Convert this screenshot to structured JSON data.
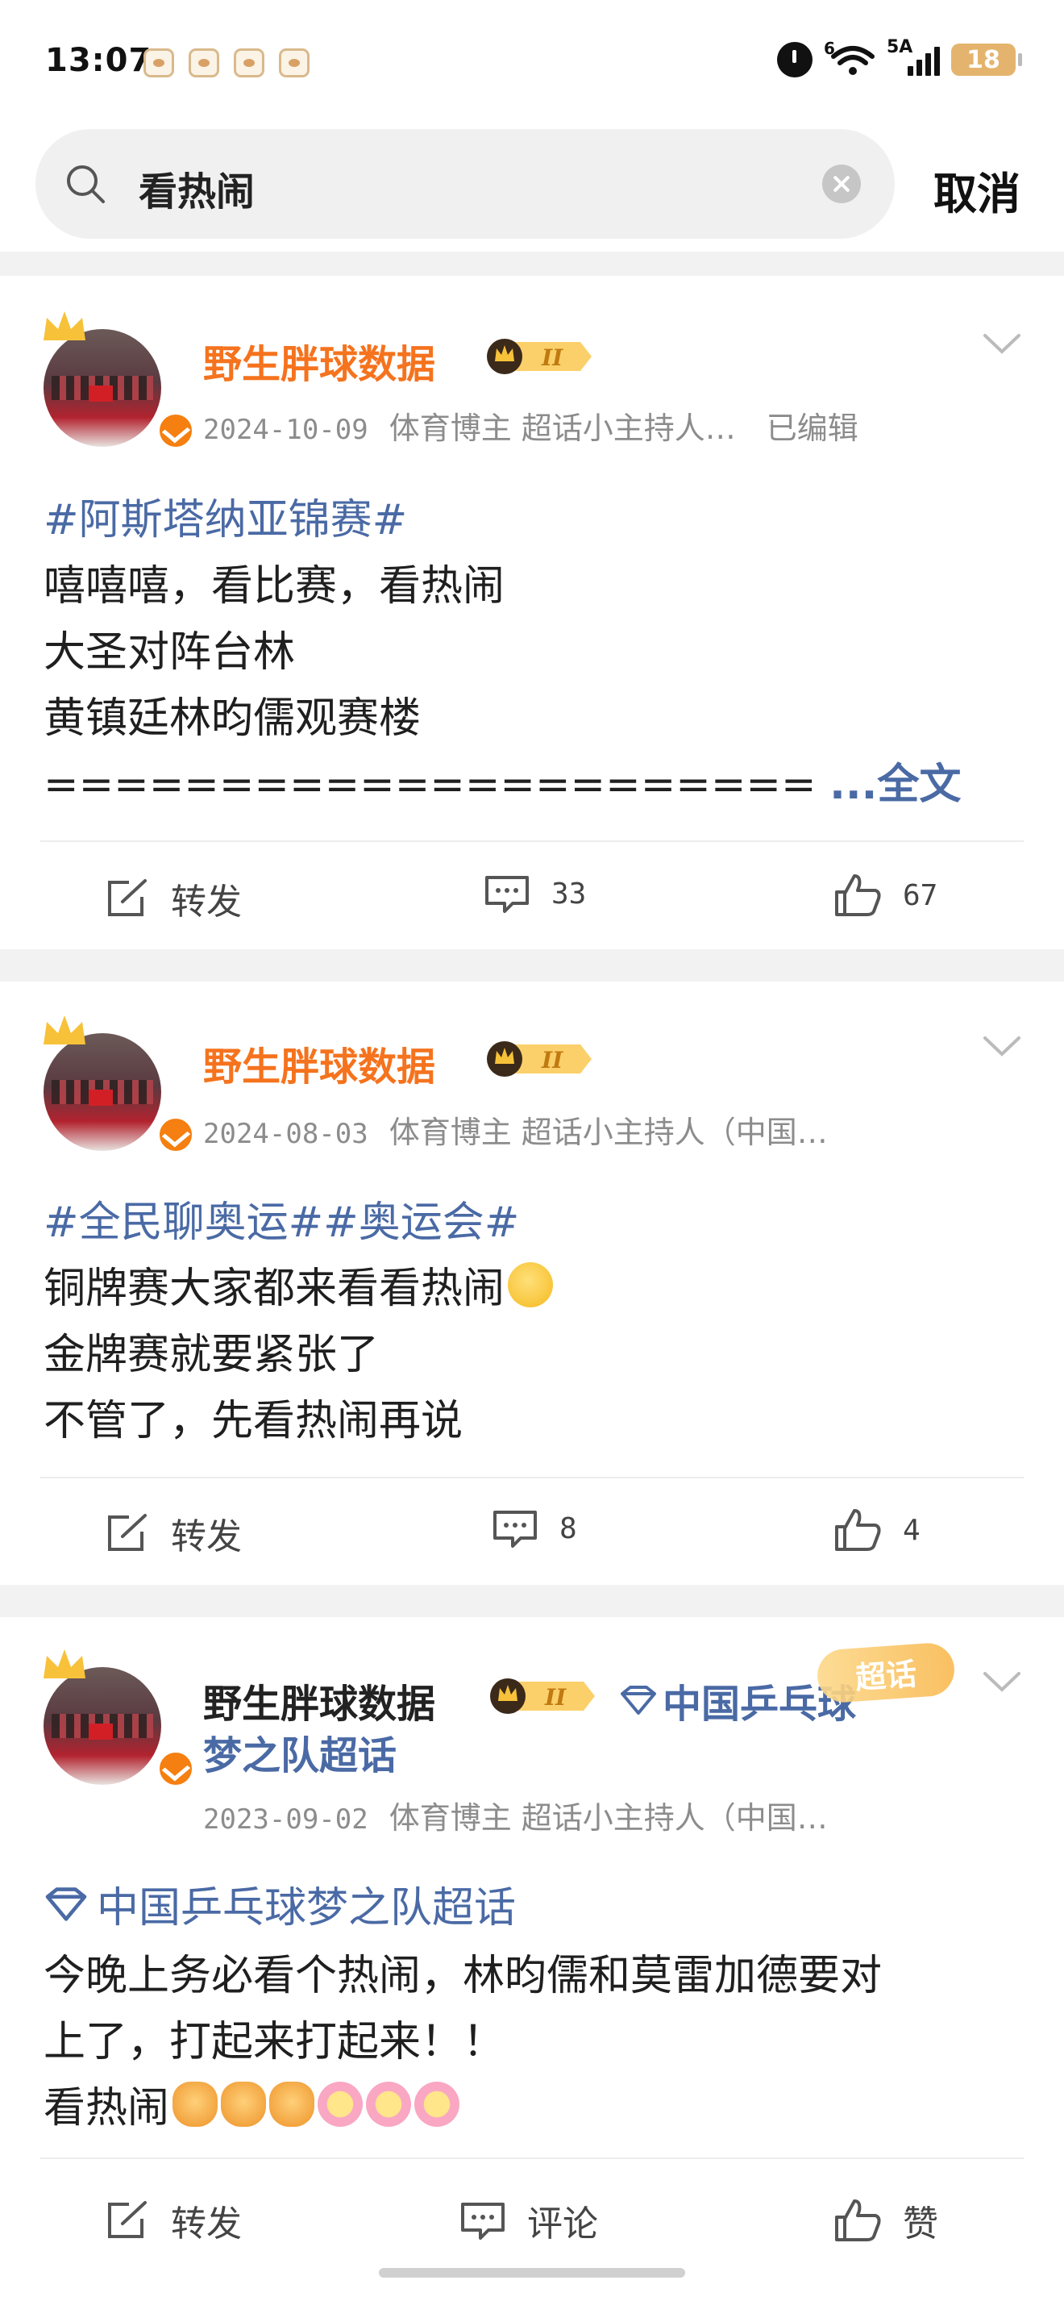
{
  "status_bar": {
    "time": "13:07",
    "wifi_tag": "6",
    "network_tag": "5A",
    "battery": "18"
  },
  "search": {
    "query": "看热闹",
    "cancel_label": "取消"
  },
  "posts": [
    {
      "user": "野生胖球数据",
      "date": "2024-10-09",
      "meta": "体育博主 超话小主持人…",
      "edited": "已编辑",
      "lines": [
        "#阿斯塔纳亚锦赛#",
        "嘻嘻嘻，看比赛，看热闹",
        "大圣对阵台林",
        "黄镇廷林昀儒观赛楼",
        "======================",
        "...全文"
      ],
      "repost": "转发",
      "comments": "33",
      "likes": "67"
    },
    {
      "user": "野生胖球数据",
      "date": "2024-08-03",
      "meta": "体育博主 超话小主持人（中国…",
      "lines": [
        "#全民聊奥运#",
        "#奥运会#",
        "铜牌赛大家都来看看热闹",
        "金牌赛就要紧张了",
        "不管了，先看热闹再说"
      ],
      "repost": "转发",
      "comments": "8",
      "likes": "4"
    },
    {
      "user": "野生胖球数据",
      "topic_part1": "中国乒乓球",
      "topic_part2": "梦之队超话",
      "supertalk_label": "超话",
      "date": "2023-09-02",
      "meta": "体育博主 超话小主持人（中国…",
      "lines": [
        "中国乒乓球梦之队超话",
        "今晚上务必看个热闹，林昀儒和莫雷加德要对",
        "上了，打起来打起来！！",
        "看热闹"
      ],
      "repost": "转发",
      "comments": "评论",
      "likes": "赞"
    }
  ],
  "colors": {
    "username": "#f5731e",
    "topic": "#4a6aa5",
    "meta": "#8c8c8c",
    "separator": "#f2f2f2"
  }
}
